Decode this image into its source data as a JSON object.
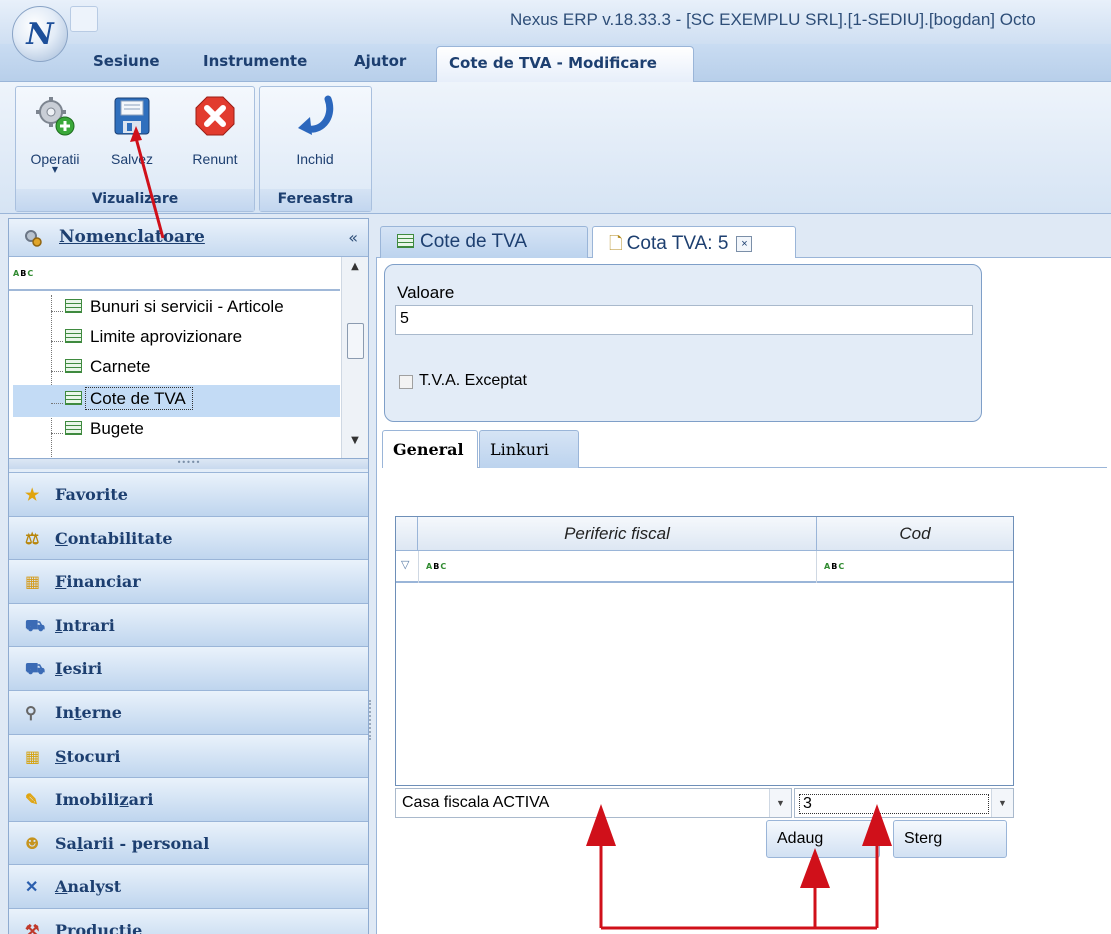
{
  "window": {
    "title": "Nexus ERP v.18.33.3 - [SC EXEMPLU SRL].[1-SEDIU].[bogdan] Octo",
    "logo_letter": "N"
  },
  "menu": {
    "items": [
      "Sesiune",
      "Instrumente",
      "Ajutor"
    ],
    "active_tab": "Cote de TVA - Modificare"
  },
  "ribbon": {
    "groups": [
      {
        "label": "Vizualizare",
        "buttons": [
          {
            "label": "Operatii",
            "icon": "gears-add-icon"
          },
          {
            "label": "Salvez",
            "icon": "floppy-disk-icon"
          },
          {
            "label": "Renunt",
            "icon": "cancel-x-icon"
          }
        ]
      },
      {
        "label": "Fereastra",
        "buttons": [
          {
            "label": "Inchid",
            "icon": "close-arrow-icon"
          }
        ]
      }
    ]
  },
  "left_panel": {
    "title": "Nomenclatoare",
    "collapse": "«",
    "filter_icon": "abc-filter-icon",
    "tree_items": [
      "Bunuri si servicii - Articole",
      "Limite aprovizionare",
      "Carnete",
      "Cote de TVA",
      "Bugete"
    ],
    "selected_item": "Cote de TVA",
    "splitter_dots": "•••••",
    "nav": [
      {
        "label_pre": "",
        "label_ul": "",
        "label": "Favorite",
        "icon": "★",
        "icon_color": "#e0a40e"
      },
      {
        "label_pre": "",
        "label_ul": "C",
        "label": "ontabilitate",
        "icon": "⚖",
        "icon_color": "#b8860b"
      },
      {
        "label_pre": "",
        "label_ul": "F",
        "label": "inanciar",
        "icon": "▦",
        "icon_color": "#d59b1a"
      },
      {
        "label_pre": "",
        "label_ul": "I",
        "label": "ntrari",
        "icon": "⛟",
        "icon_color": "#3b6bb5"
      },
      {
        "label_pre": "",
        "label_ul": "I",
        "label": "esiri",
        "icon": "⛟",
        "icon_color": "#3b6bb5"
      },
      {
        "label_pre": "In",
        "label_ul": "t",
        "label": "erne",
        "icon": "⚲",
        "icon_color": "#666666"
      },
      {
        "label_pre": "",
        "label_ul": "S",
        "label": "tocuri",
        "icon": "▦",
        "icon_color": "#d5a20e"
      },
      {
        "label_pre": "Imobili",
        "label_ul": "z",
        "label": "ari",
        "icon": "✎",
        "icon_color": "#e0a40e"
      },
      {
        "label_pre": "Sa",
        "label_ul": "l",
        "label": "arii - personal",
        "icon": "☻",
        "icon_color": "#c6941e"
      },
      {
        "label_pre": "",
        "label_ul": "A",
        "label": "nalyst",
        "icon": "✕",
        "icon_color": "#2b5fae"
      },
      {
        "label_pre": "",
        "label_ul": "P",
        "label": "roductie",
        "icon": "⚒",
        "icon_color": "#c0392b"
      }
    ]
  },
  "doc_tabs": [
    {
      "label": "Cote de TVA",
      "icon": "table-icon"
    },
    {
      "label": "Cota TVA: 5",
      "icon": "new-doc-icon",
      "close": "×"
    }
  ],
  "form": {
    "valoare_label": "Valoare",
    "valoare_value": "5",
    "tva_exceptat_label": "T.V.A. Exceptat",
    "tva_exceptat_checked": false
  },
  "sub_tabs": [
    "General",
    "Linkuri"
  ],
  "grid": {
    "columns": [
      "Periferic fiscal",
      "Cod"
    ],
    "rows": []
  },
  "combos": {
    "periferic_value": "Casa fiscala ACTIVA",
    "cod_value": "3"
  },
  "buttons": {
    "adaug": "Adaug",
    "sterg": "Sterg"
  },
  "annotation_color": "#d0101a"
}
